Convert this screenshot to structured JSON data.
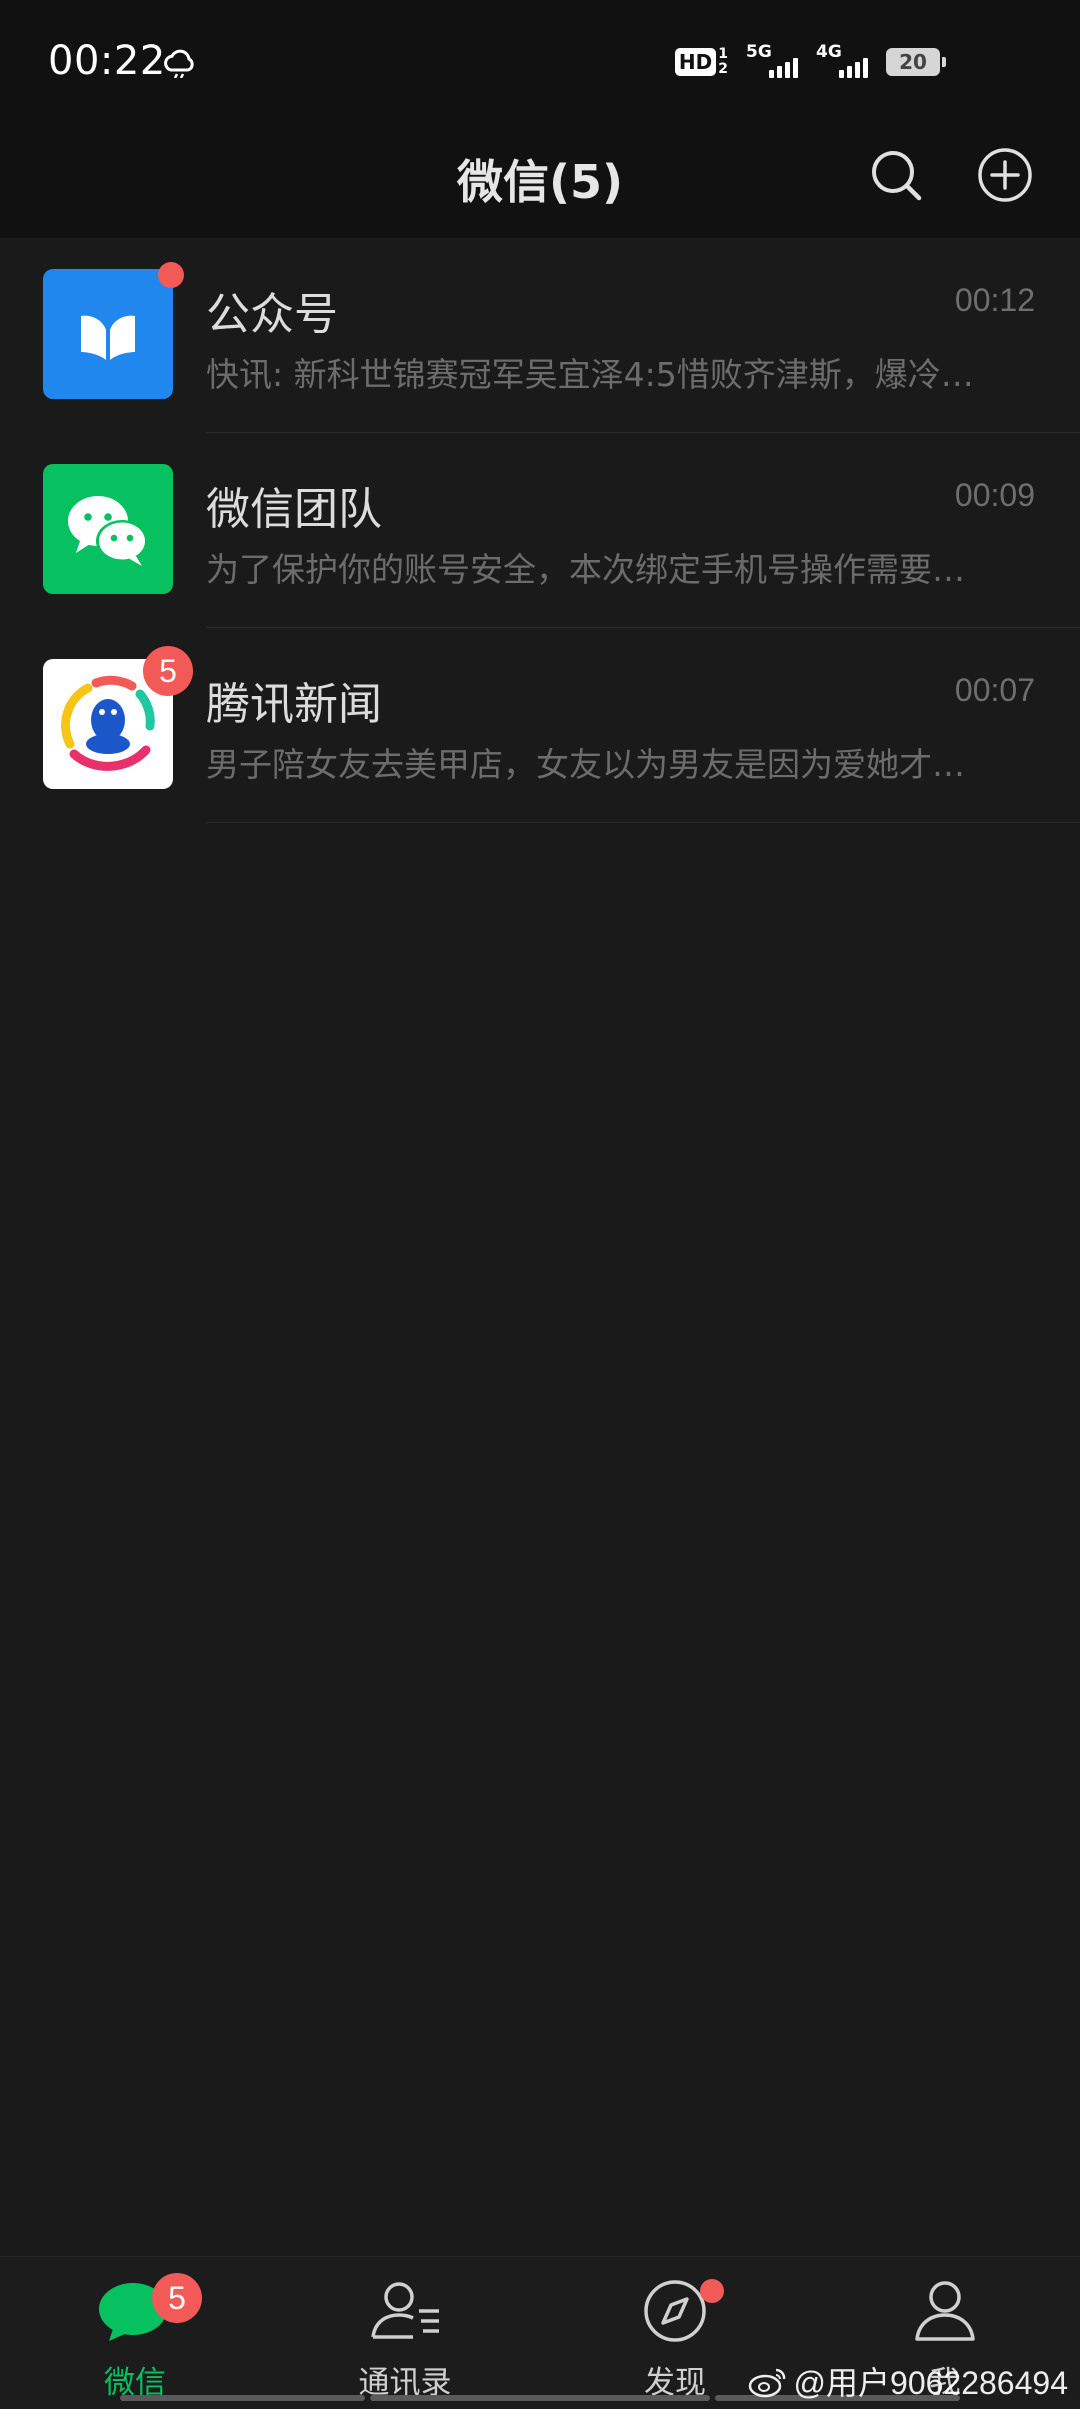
{
  "status_bar": {
    "time": "00:22",
    "hd_label": "HD",
    "hd_sim_top": "1",
    "hd_sim_bottom": "2",
    "network_1": "5G",
    "network_2": "4G",
    "battery": "20",
    "icons": [
      "weather-icon",
      "hd-icon",
      "signal-icon",
      "battery-icon"
    ]
  },
  "header": {
    "title": "微信(5)",
    "search_icon": "search-icon",
    "add_icon": "plus-circle-icon"
  },
  "chats": [
    {
      "name": "公众号",
      "time": "00:12",
      "preview": "快讯: 新科世锦赛冠军吴宜泽4:5惜败齐津斯，爆冷…",
      "avatar_icon": "official-accounts-icon",
      "avatar_color": "#1f87ee",
      "badge": "dot"
    },
    {
      "name": "微信团队",
      "time": "00:09",
      "preview": "为了保护你的账号安全，本次绑定手机号操作需要…",
      "avatar_icon": "wechat-icon",
      "avatar_color": "#07c160",
      "badge": ""
    },
    {
      "name": "腾讯新闻",
      "time": "00:07",
      "preview": "男子陪女友去美甲店，女友以为男友是因为爱她才…",
      "avatar_icon": "tencent-news-icon",
      "avatar_color": "#ffffff",
      "badge": "5"
    }
  ],
  "tabs": [
    {
      "label": "微信",
      "icon": "chat-bubble-icon",
      "active": true,
      "badge": "5"
    },
    {
      "label": "通讯录",
      "icon": "contacts-icon",
      "active": false,
      "badge": ""
    },
    {
      "label": "发现",
      "icon": "compass-icon",
      "active": false,
      "badge": "dot"
    },
    {
      "label": "我",
      "icon": "person-icon",
      "active": false,
      "badge": ""
    }
  ],
  "watermark": {
    "text": "@用户9062286494",
    "icon": "weibo-icon"
  },
  "colors": {
    "accent": "#07c160",
    "badge": "#f25a57",
    "background": "#1a1a1a",
    "header": "#111111"
  }
}
